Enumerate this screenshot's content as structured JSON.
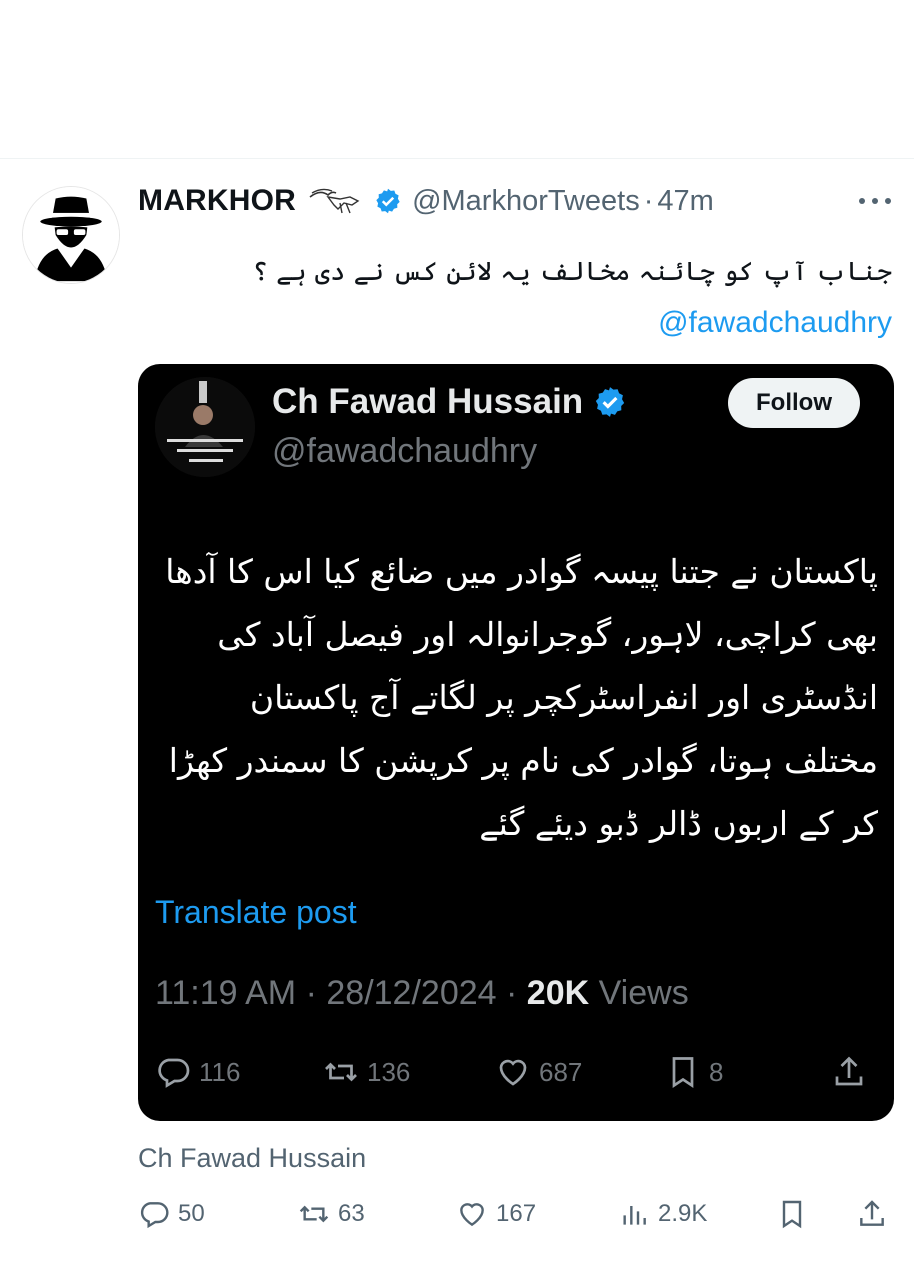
{
  "tweet": {
    "display_name": "MARKHOR",
    "handle": "@MarkhorTweets",
    "separator": "·",
    "time": "47m",
    "text": "جناب آپ کو چائنہ مخالف یہ لائن کس نے دی ہے ؟",
    "mention": "@fawadchaudhry",
    "reply_source": "Ch Fawad Hussain",
    "stats": {
      "replies": "50",
      "retweets": "63",
      "likes": "167",
      "views": "2.9K"
    }
  },
  "quoted": {
    "display_name": "Ch Fawad Hussain",
    "handle": "@fawadchaudhry",
    "follow_label": "Follow",
    "body": "پاکستان نے جتنا پیسہ گوادر میں ضائع کیا اس کا آدھا بھی کراچی، لاہور، گوجرانوالہ اور فیصل آباد کی انڈسٹری اور انفراسٹرکچر پر لگاتے آج پاکستان مختلف ہوتا، گوادر کی نام پر کرپشن کا سمندر کھڑا کر کے اربوں ڈالر ڈبو دیئے گئے",
    "translate_label": "Translate post",
    "time": "11:19 AM",
    "date": "28/12/2024",
    "separator": "·",
    "views_count": "20K",
    "views_label": "Views",
    "stats": {
      "replies": "116",
      "retweets": "136",
      "likes": "687",
      "bookmarks": "8"
    }
  },
  "colors": {
    "accent": "#1d9bf0",
    "secondary": "#536471",
    "card_bg": "#000000"
  },
  "icons": [
    "spy-avatar-icon",
    "markhor-emoji-icon",
    "verified-badge-icon",
    "more-icon",
    "reply-icon",
    "retweet-icon",
    "like-icon",
    "bookmark-icon",
    "share-icon",
    "views-icon"
  ]
}
